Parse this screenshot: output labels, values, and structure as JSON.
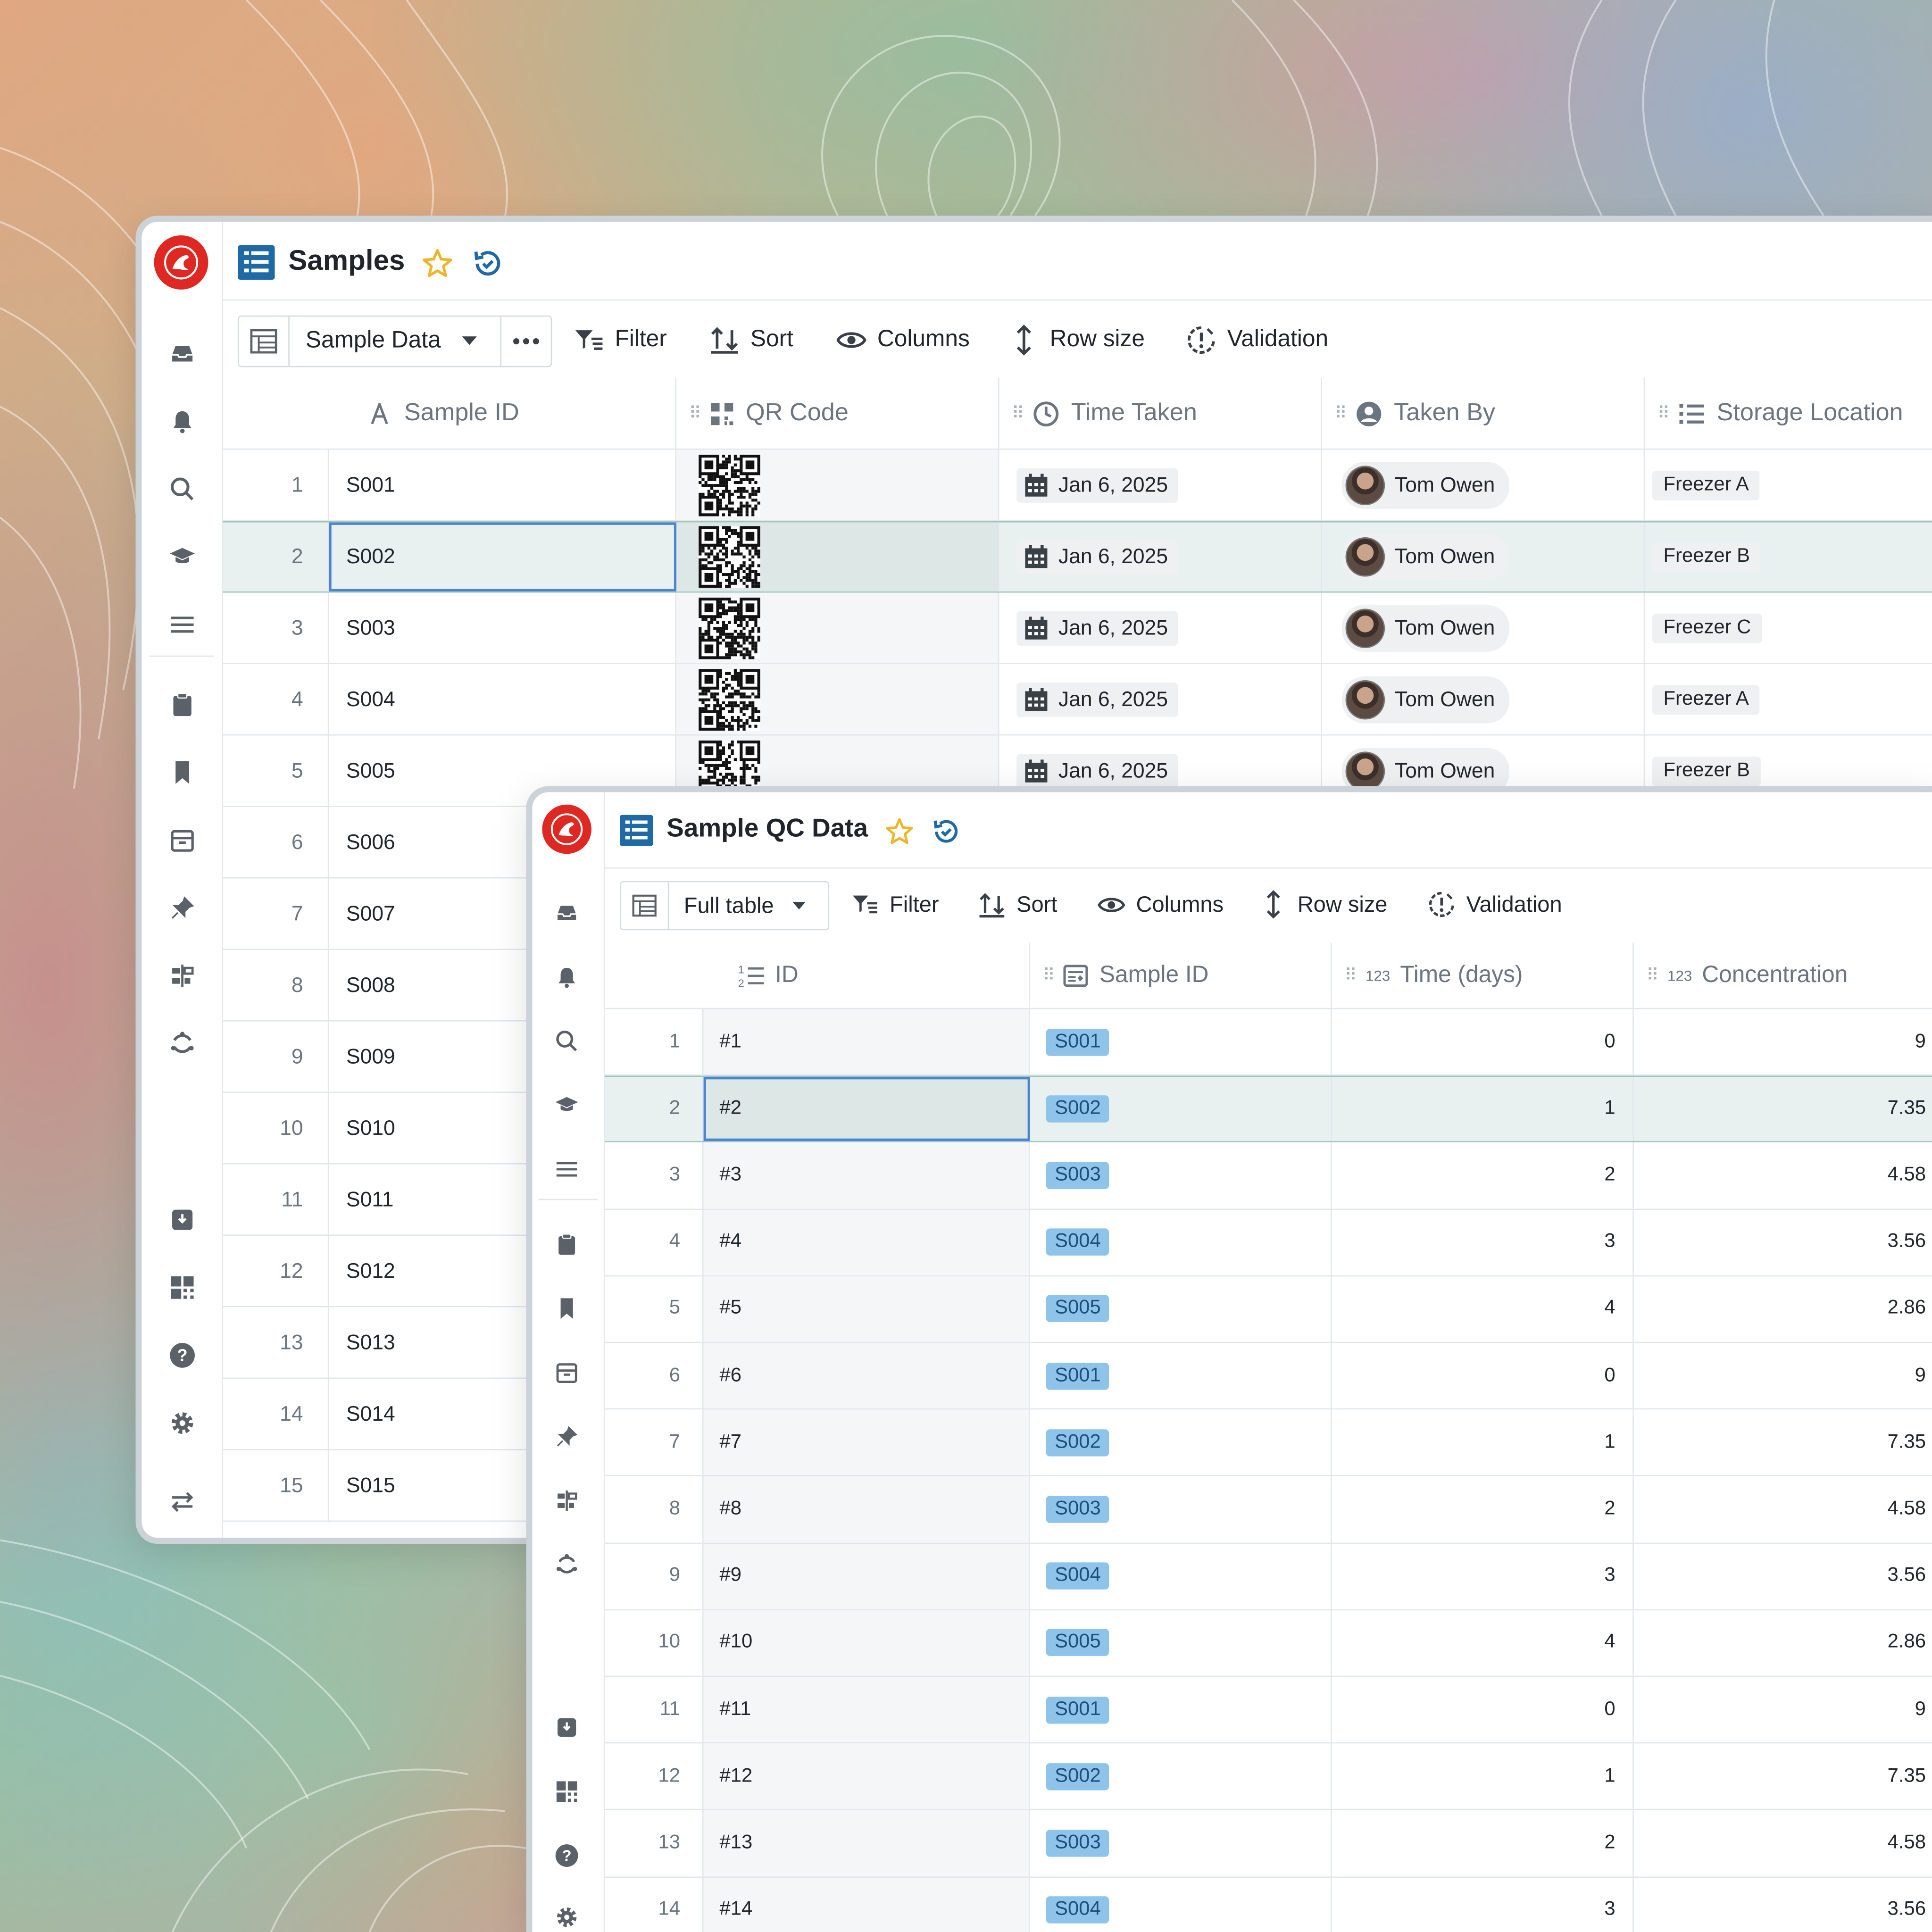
{
  "samples_window": {
    "title": "Samples",
    "view_name": "Sample Data",
    "toolbar": [
      "Filter",
      "Sort",
      "Columns",
      "Row size",
      "Validation"
    ],
    "columns": [
      "Sample ID",
      "QR Code",
      "Time Taken",
      "Taken By",
      "Storage Location"
    ],
    "rows": [
      {
        "n": "1",
        "id": "S001",
        "date": "Jan 6, 2025",
        "user": "Tom Owen",
        "loc": "Freezer A"
      },
      {
        "n": "2",
        "id": "S002",
        "date": "Jan 6, 2025",
        "user": "Tom Owen",
        "loc": "Freezer B"
      },
      {
        "n": "3",
        "id": "S003",
        "date": "Jan 6, 2025",
        "user": "Tom Owen",
        "loc": "Freezer C"
      },
      {
        "n": "4",
        "id": "S004",
        "date": "Jan 6, 2025",
        "user": "Tom Owen",
        "loc": "Freezer A"
      },
      {
        "n": "5",
        "id": "S005",
        "date": "Jan 6, 2025",
        "user": "Tom Owen",
        "loc": "Freezer B"
      },
      {
        "n": "6",
        "id": "S006"
      },
      {
        "n": "7",
        "id": "S007"
      },
      {
        "n": "8",
        "id": "S008"
      },
      {
        "n": "9",
        "id": "S009"
      },
      {
        "n": "10",
        "id": "S010"
      },
      {
        "n": "11",
        "id": "S011"
      },
      {
        "n": "12",
        "id": "S012"
      },
      {
        "n": "13",
        "id": "S013"
      },
      {
        "n": "14",
        "id": "S014"
      },
      {
        "n": "15",
        "id": "S015"
      }
    ],
    "selected_row": 2
  },
  "qc_window": {
    "title": "Sample QC Data",
    "view_name": "Full table",
    "toolbar": [
      "Filter",
      "Sort",
      "Columns",
      "Row size",
      "Validation"
    ],
    "columns": [
      "ID",
      "Sample ID",
      "Time (days)",
      "Concentration"
    ],
    "number_badge": "123",
    "rows": [
      {
        "n": "1",
        "id": "#1",
        "sample": "S001",
        "time": "0",
        "conc": "9"
      },
      {
        "n": "2",
        "id": "#2",
        "sample": "S002",
        "time": "1",
        "conc": "7.35"
      },
      {
        "n": "3",
        "id": "#3",
        "sample": "S003",
        "time": "2",
        "conc": "4.58"
      },
      {
        "n": "4",
        "id": "#4",
        "sample": "S004",
        "time": "3",
        "conc": "3.56"
      },
      {
        "n": "5",
        "id": "#5",
        "sample": "S005",
        "time": "4",
        "conc": "2.86"
      },
      {
        "n": "6",
        "id": "#6",
        "sample": "S001",
        "time": "0",
        "conc": "9"
      },
      {
        "n": "7",
        "id": "#7",
        "sample": "S002",
        "time": "1",
        "conc": "7.35"
      },
      {
        "n": "8",
        "id": "#8",
        "sample": "S003",
        "time": "2",
        "conc": "4.58"
      },
      {
        "n": "9",
        "id": "#9",
        "sample": "S004",
        "time": "3",
        "conc": "3.56"
      },
      {
        "n": "10",
        "id": "#10",
        "sample": "S005",
        "time": "4",
        "conc": "2.86"
      },
      {
        "n": "11",
        "id": "#11",
        "sample": "S001",
        "time": "0",
        "conc": "9"
      },
      {
        "n": "12",
        "id": "#12",
        "sample": "S002",
        "time": "1",
        "conc": "7.35"
      },
      {
        "n": "13",
        "id": "#13",
        "sample": "S003",
        "time": "2",
        "conc": "4.58"
      },
      {
        "n": "14",
        "id": "#14",
        "sample": "S004",
        "time": "3",
        "conc": "3.56"
      }
    ],
    "selected_row": 2
  },
  "colors": {
    "accent": "#1f6aa5",
    "logo": "#e02822",
    "star": "#f0b429",
    "selection_row": "#e8f1ef",
    "active_cell_border": "#4a84d6",
    "tag_blue": "#8fc4ea"
  }
}
